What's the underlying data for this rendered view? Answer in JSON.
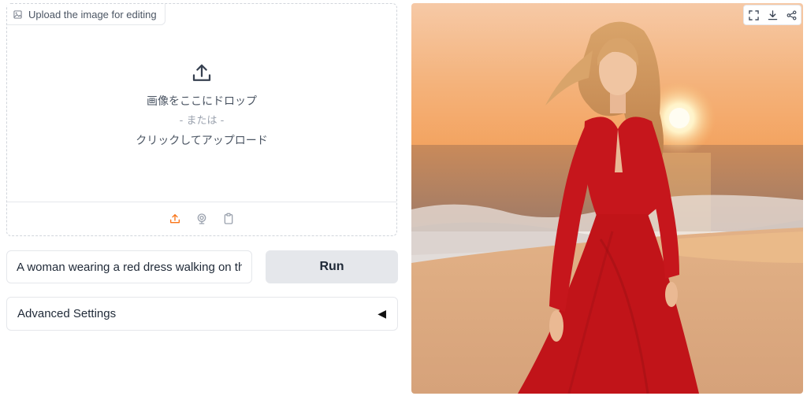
{
  "upload": {
    "label": "Upload the image for editing",
    "drop_text": "画像をここにドロップ",
    "or_text": "- または -",
    "click_text": "クリックしてアップロード",
    "sources": [
      "upload-icon",
      "webcam-icon",
      "clipboard-icon"
    ],
    "active_source_color": "#f97316"
  },
  "prompt": {
    "value": "A woman wearing a red dress walking on the beach at sunset"
  },
  "run_label": "Run",
  "advanced": {
    "label": "Advanced Settings",
    "caret": "◀"
  },
  "output": {
    "toolbar": [
      "fullscreen-icon",
      "download-icon",
      "share-icon"
    ]
  }
}
